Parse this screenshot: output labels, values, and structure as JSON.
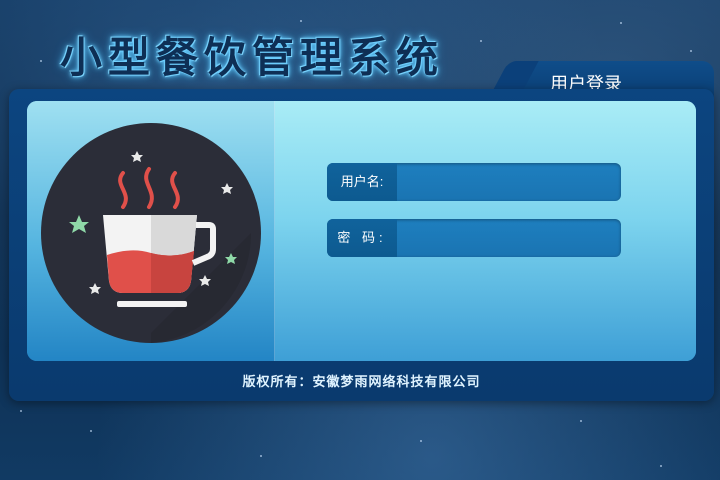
{
  "app": {
    "title": "小型餐饮管理系统"
  },
  "login_tab": {
    "label": "用户登录"
  },
  "form": {
    "username": {
      "label": "用户名:",
      "value": ""
    },
    "password": {
      "label": "密  码:",
      "value": ""
    }
  },
  "footer": {
    "copyright": "版权所有：安徽梦雨网络科技有限公司"
  },
  "logo": {
    "icon": "coffee-cup-icon"
  },
  "colors": {
    "background": "#0c2a4a",
    "frame": "#0a3e73",
    "panel_light": "#9fe0f1",
    "field": "#1a74b2",
    "cup_liquid": "#e0504a",
    "logo_circle": "#2b2d38"
  }
}
